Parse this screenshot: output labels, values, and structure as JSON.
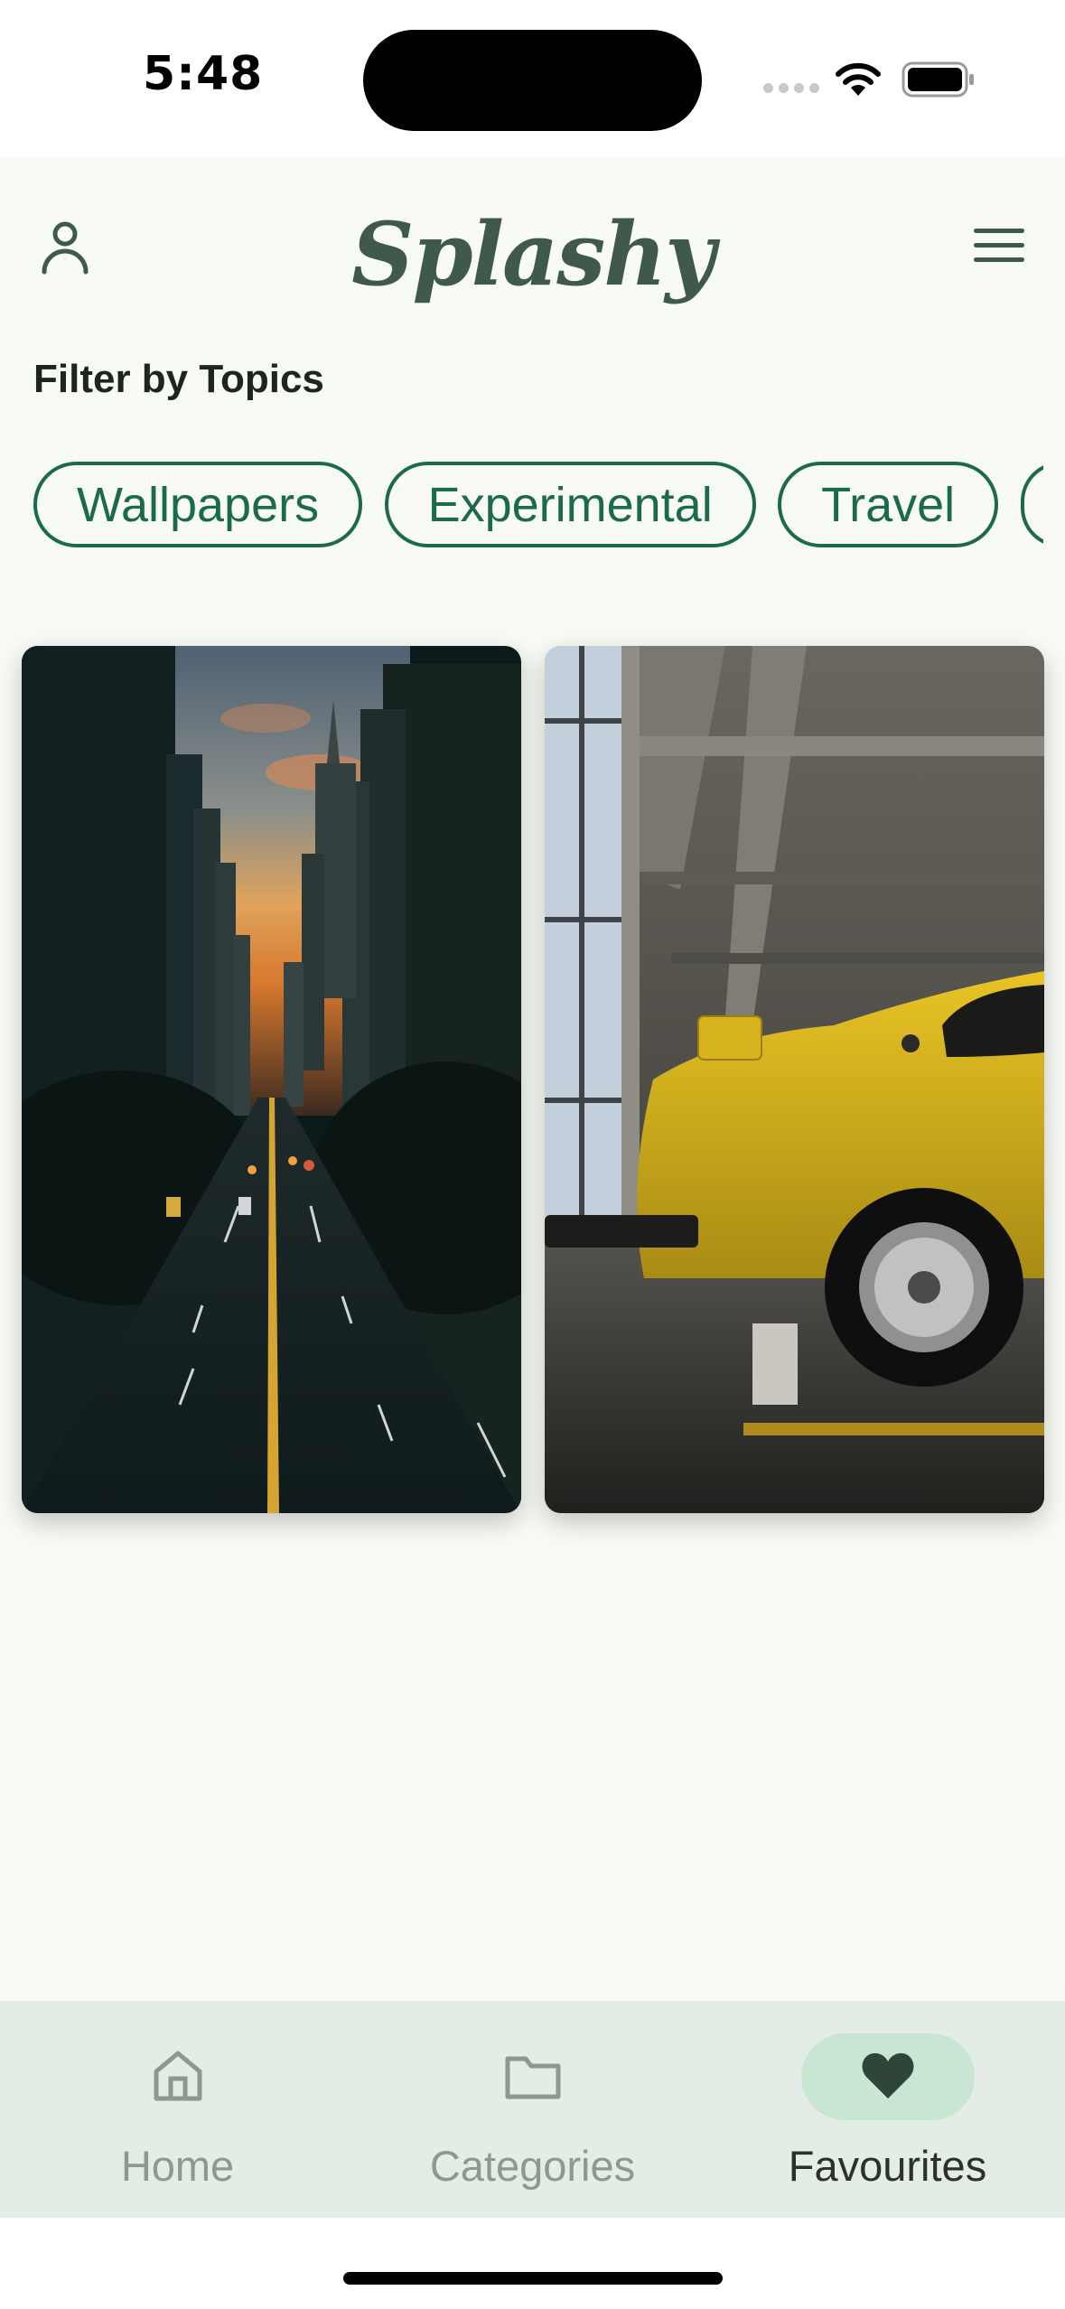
{
  "status_bar": {
    "time": "5:48"
  },
  "header": {
    "app_name": "Splashy",
    "profile_icon": "person-icon",
    "menu_icon": "hamburger-icon"
  },
  "filter": {
    "label": "Filter by Topics",
    "topics": [
      "Wallpapers",
      "Experimental",
      "Travel",
      ""
    ]
  },
  "photos": [
    {
      "subject": "city-street-sunset"
    },
    {
      "subject": "yellow-car-parking-garage"
    }
  ],
  "bottom_nav": {
    "items": [
      {
        "label": "Home",
        "icon": "home-icon"
      },
      {
        "label": "Categories",
        "icon": "folder-icon"
      },
      {
        "label": "Favourites",
        "icon": "heart-icon"
      }
    ],
    "active_index": 2
  },
  "colors": {
    "accent": "#1b6b48",
    "logo": "#3f5a4c",
    "app_background": "#f8faf5",
    "nav_background": "#e3ede5",
    "active_pill": "#c9e6d3"
  }
}
